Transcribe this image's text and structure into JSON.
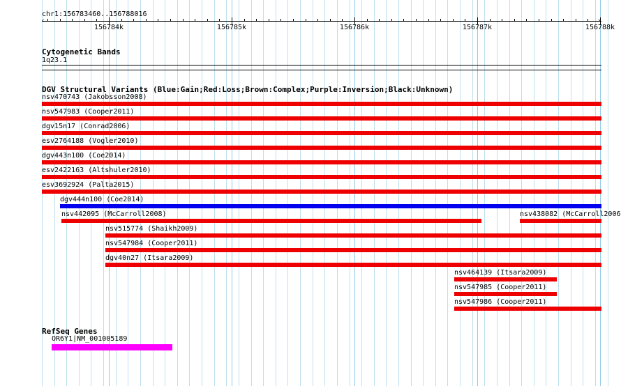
{
  "ruler": {
    "location": "chr1:156783460..156788016",
    "ticks": [
      "156784k",
      "156785k",
      "156786k",
      "156787k",
      "156788k"
    ]
  },
  "cytobands": {
    "title": "Cytogenetic Bands",
    "band": "1q23.1"
  },
  "dgv": {
    "title": "DGV Structural Variants (Blue:Gain;Red:Loss;Brown:Complex;Purple:Inversion;Black:Unknown)",
    "colors": {
      "gain": "#0000ee",
      "loss": "#ee0000"
    },
    "features": [
      {
        "id": "nsv470743",
        "study": "Jakobsson2008",
        "label": "nsv470743 (Jakobsson2008)",
        "type": "loss"
      },
      {
        "id": "nsv547983",
        "study": "Cooper2011",
        "label": "nsv547983 (Cooper2011)",
        "type": "loss"
      },
      {
        "id": "dgv15n17",
        "study": "Conrad2006",
        "label": "dgv15n17 (Conrad2006)",
        "type": "loss"
      },
      {
        "id": "esv2764188",
        "study": "Vogler2010",
        "label": "esv2764188 (Vogler2010)",
        "type": "loss"
      },
      {
        "id": "dgv443n100",
        "study": "Coe2014",
        "label": "dgv443n100 (Coe2014)",
        "type": "loss"
      },
      {
        "id": "esv2422163",
        "study": "Altshuler2010",
        "label": "esv2422163 (Altshuler2010)",
        "type": "loss"
      },
      {
        "id": "esv3692924",
        "study": "Palta2015",
        "label": "esv3692924 (Palta2015)",
        "type": "loss"
      },
      {
        "id": "dgv444n100",
        "study": "Coe2014",
        "label": "dgv444n100 (Coe2014)",
        "type": "gain"
      },
      {
        "id": "nsv442095",
        "study": "McCarroll2008",
        "label": "nsv442095 (McCarroll2008)",
        "type": "loss"
      },
      {
        "id": "nsv438082",
        "study": "McCarroll2006",
        "label": "nsv438082 (McCarroll2006",
        "type": "loss"
      },
      {
        "id": "nsv515774",
        "study": "Shaikh2009",
        "label": "nsv515774 (Shaikh2009)",
        "type": "loss"
      },
      {
        "id": "nsv547984",
        "study": "Cooper2011",
        "label": "nsv547984 (Cooper2011)",
        "type": "loss"
      },
      {
        "id": "dgv40n27",
        "study": "Itsara2009",
        "label": "dgv40n27 (Itsara2009)",
        "type": "loss"
      },
      {
        "id": "nsv464139",
        "study": "Itsara2009",
        "label": "nsv464139 (Itsara2009)",
        "type": "loss"
      },
      {
        "id": "nsv547985",
        "study": "Cooper2011",
        "label": "nsv547985 (Cooper2011)",
        "type": "loss"
      },
      {
        "id": "nsv547986",
        "study": "Cooper2011",
        "label": "nsv547986 (Cooper2011)",
        "type": "loss"
      }
    ]
  },
  "refseq": {
    "title": "RefSeq Genes",
    "genes": [
      {
        "label": "OR6Y1|NM_001005189",
        "color": "#ff00ff"
      }
    ]
  }
}
